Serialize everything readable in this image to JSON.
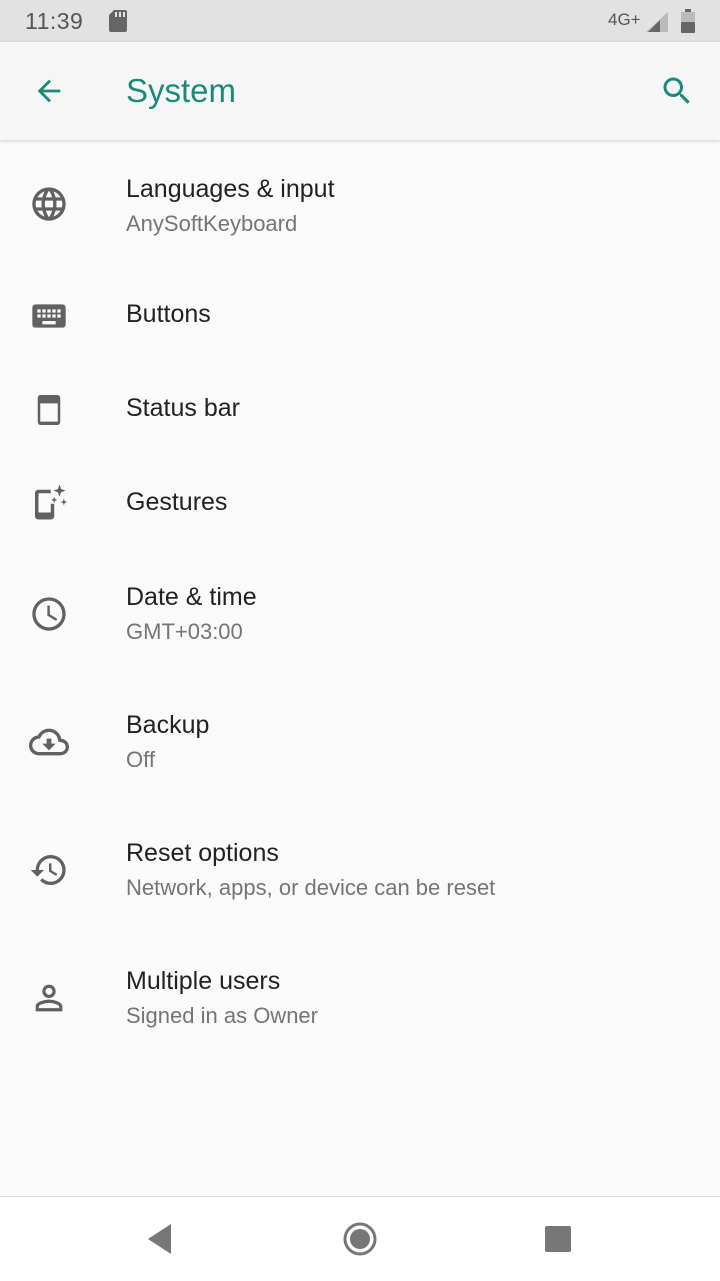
{
  "status_bar": {
    "time": "11:39",
    "network": "4G+",
    "icons": [
      "sd-card-icon",
      "signal-icon",
      "battery-icon"
    ]
  },
  "app_bar": {
    "title": "System",
    "back_icon": "arrow-back-icon",
    "search_icon": "search-icon",
    "accent_color": "#1a8a7c"
  },
  "settings": [
    {
      "title": "Languages & input",
      "subtitle": "AnySoftKeyboard",
      "icon": "globe-icon"
    },
    {
      "title": "Buttons",
      "subtitle": "",
      "icon": "keyboard-icon"
    },
    {
      "title": "Status bar",
      "subtitle": "",
      "icon": "status-bar-icon"
    },
    {
      "title": "Gestures",
      "subtitle": "",
      "icon": "gestures-icon"
    },
    {
      "title": "Date & time",
      "subtitle": "GMT+03:00",
      "icon": "clock-icon"
    },
    {
      "title": "Backup",
      "subtitle": "Off",
      "icon": "cloud-backup-icon"
    },
    {
      "title": "Reset options",
      "subtitle": "Network, apps, or device can be reset",
      "icon": "history-icon"
    },
    {
      "title": "Multiple users",
      "subtitle": "Signed in as Owner",
      "icon": "person-icon"
    }
  ],
  "nav_bar": {
    "icons": [
      "back-triangle-icon",
      "home-circle-icon",
      "recents-square-icon"
    ]
  }
}
